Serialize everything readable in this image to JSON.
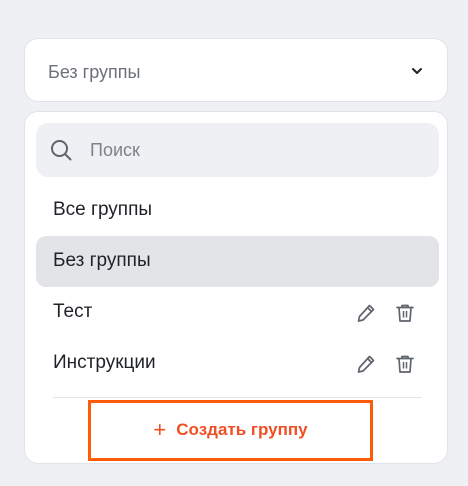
{
  "group_select": {
    "value": "Без группы",
    "icon": "chevron-down-icon"
  },
  "dropdown": {
    "search": {
      "placeholder": "Поиск",
      "value": "",
      "icon": "search-icon"
    },
    "items": [
      {
        "label": "Все группы",
        "selected": false
      },
      {
        "label": "Без группы",
        "selected": true
      },
      {
        "label": "Тест",
        "selected": false,
        "actions": [
          "pencil-icon",
          "trash-icon"
        ]
      },
      {
        "label": "Инструкции",
        "selected": false,
        "actions": [
          "pencil-icon",
          "trash-icon"
        ]
      }
    ],
    "create_button": {
      "plus": "+",
      "label": "Создать группу"
    }
  },
  "colors": {
    "accent": "#f04e23",
    "highlight_border": "#ff5c0a",
    "selected_bg": "#e2e4e8",
    "page_bg": "#eef0f3"
  }
}
